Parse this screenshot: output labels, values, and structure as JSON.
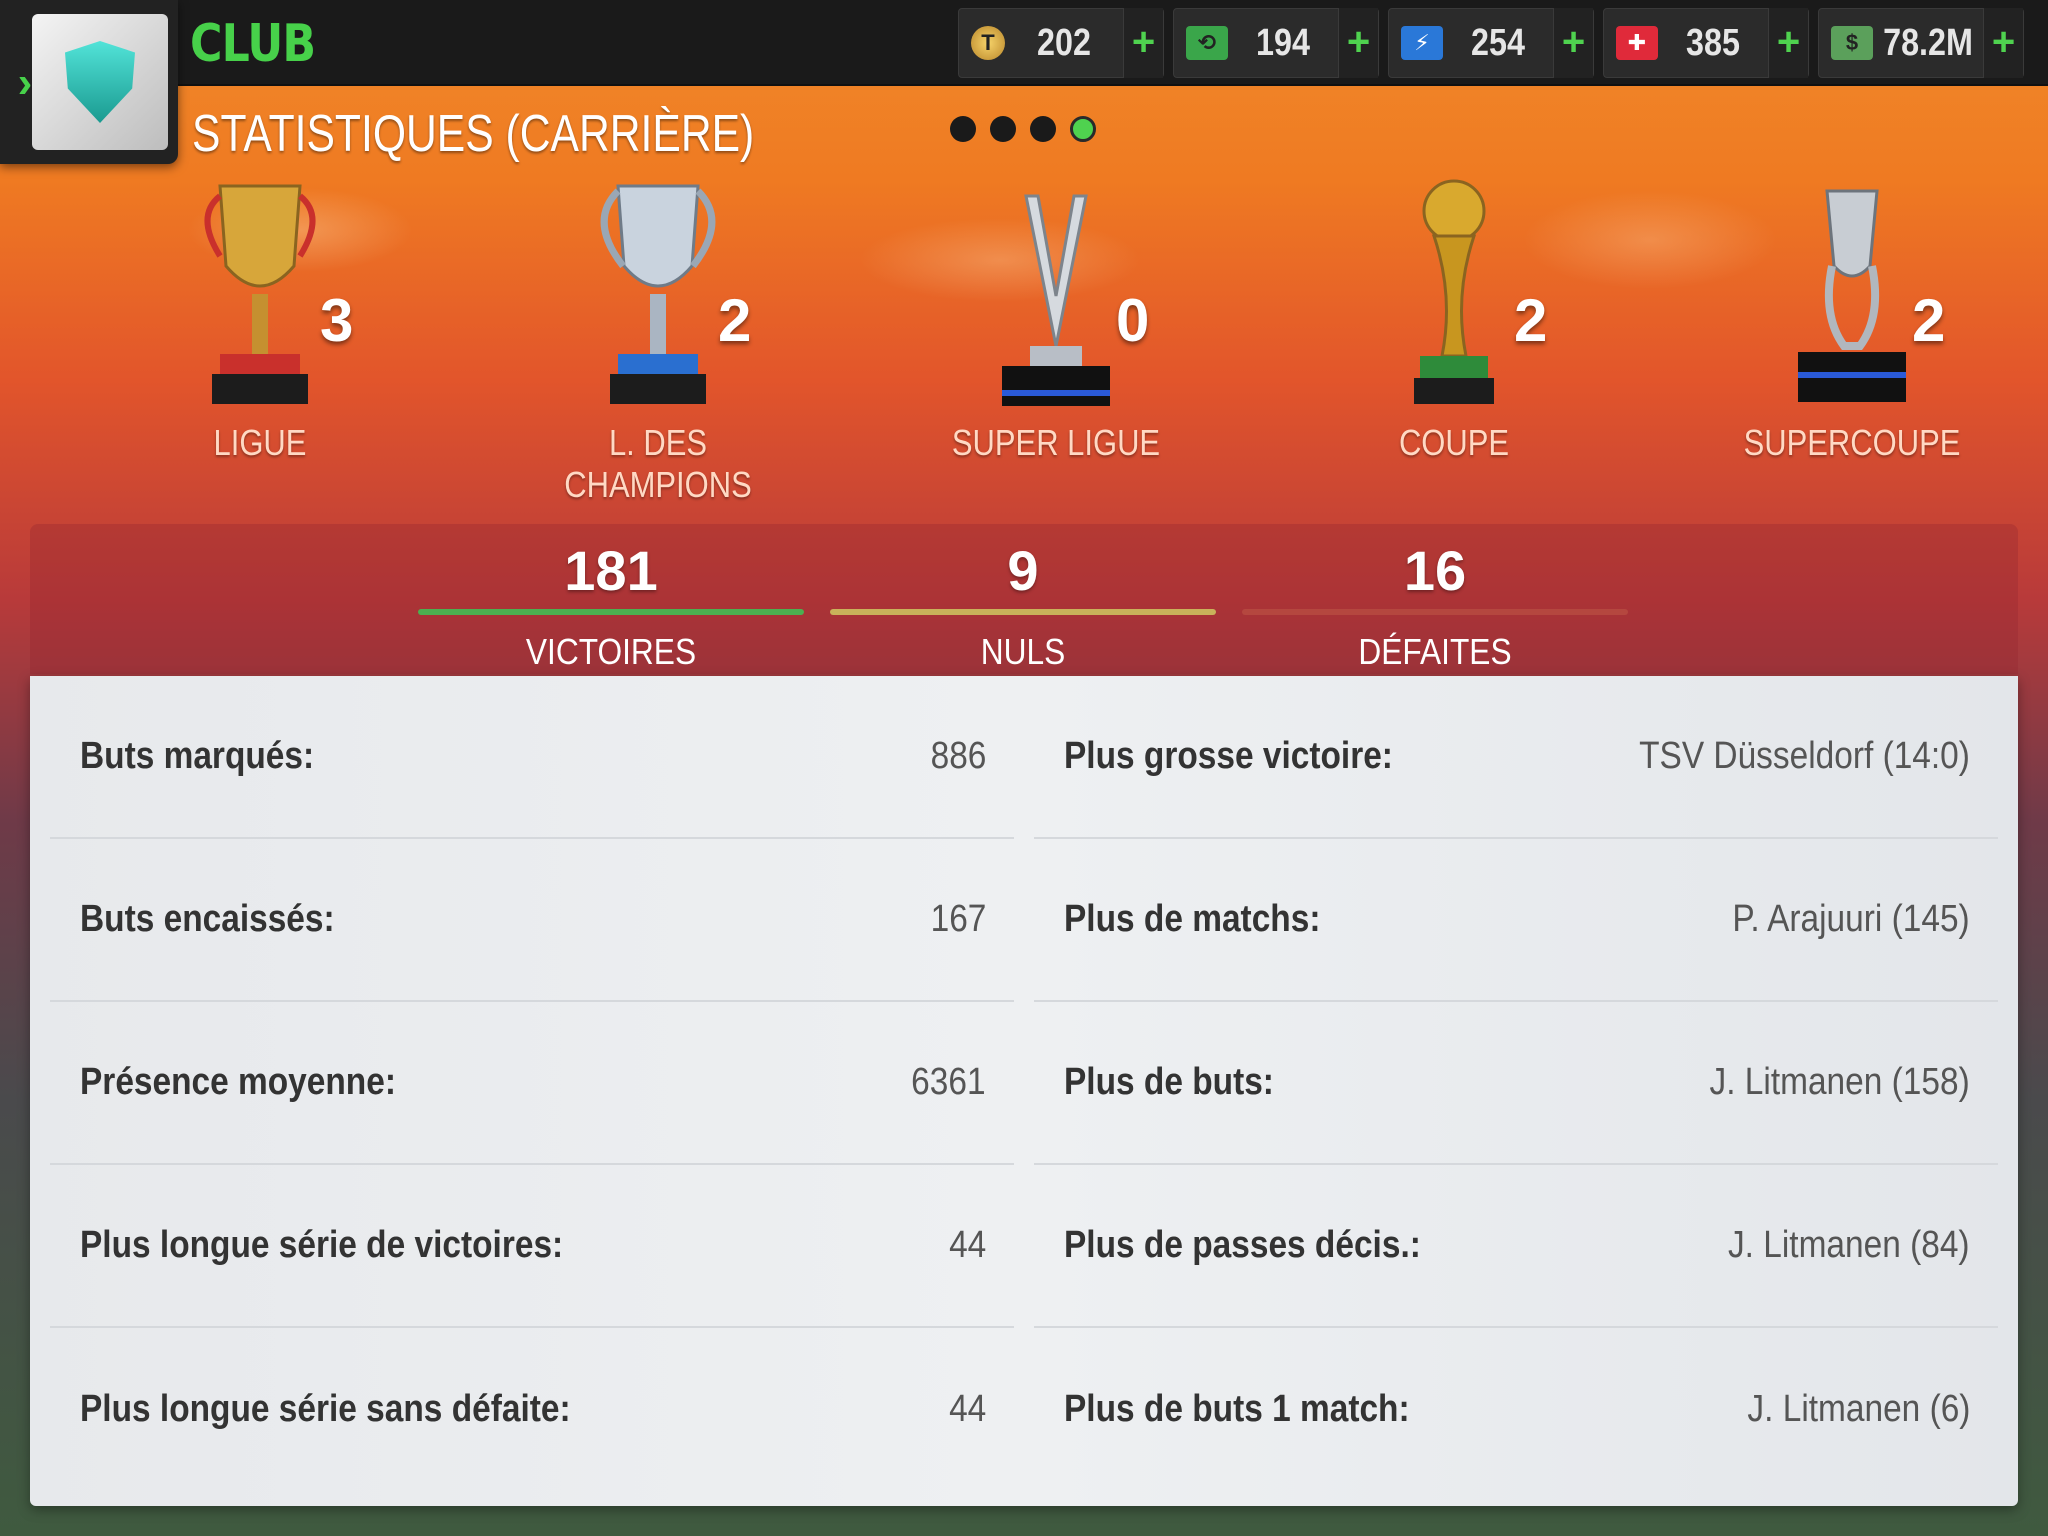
{
  "header": {
    "title": "CLUB",
    "subtitle": "STATISTIQUES (CARRIÈRE)",
    "page_dots": 4,
    "active_page": 4
  },
  "currencies": [
    {
      "icon": "token-coin-icon",
      "value": "202"
    },
    {
      "icon": "ticket-icon",
      "value": "194"
    },
    {
      "icon": "energy-icon",
      "value": "254"
    },
    {
      "icon": "medic-icon",
      "value": "385"
    },
    {
      "icon": "cash-icon",
      "value": "78.2M"
    }
  ],
  "plus_label": "+",
  "trophies": [
    {
      "name": "LIGUE",
      "count": "3",
      "color": "#d7a63a"
    },
    {
      "name": "L. DES CHAMPIONS",
      "count": "2",
      "color": "#c9d3de"
    },
    {
      "name": "SUPER LIGUE",
      "count": "0",
      "color": "#d6dadf"
    },
    {
      "name": "COUPE",
      "count": "2",
      "color": "#d9a92e"
    },
    {
      "name": "SUPERCOUPE",
      "count": "2",
      "color": "#c8cdd3"
    }
  ],
  "record": {
    "wins": {
      "value": "181",
      "label": "VICTOIRES",
      "color": "#4caf50"
    },
    "draws": {
      "value": "9",
      "label": "NULS",
      "color": "#c9b25a"
    },
    "losses": {
      "value": "16",
      "label": "DÉFAITES",
      "color": "#b5473f"
    }
  },
  "stats_left": [
    {
      "label": "Buts marqués:",
      "value": "886"
    },
    {
      "label": "Buts encaissés:",
      "value": "167"
    },
    {
      "label": "Présence moyenne:",
      "value": "6361"
    },
    {
      "label": "Plus longue série de victoires:",
      "value": "44"
    },
    {
      "label": "Plus longue série sans défaite:",
      "value": "44"
    }
  ],
  "stats_right": [
    {
      "label": "Plus grosse victoire:",
      "value": "TSV Düsseldorf (14:0)"
    },
    {
      "label": "Plus de matchs:",
      "value": "P. Arajuuri (145)"
    },
    {
      "label": "Plus de buts:",
      "value": "J. Litmanen (158)"
    },
    {
      "label": "Plus de passes décis.:",
      "value": "J. Litmanen (84)"
    },
    {
      "label": "Plus de buts 1 match:",
      "value": "J. Litmanen (6)"
    }
  ]
}
